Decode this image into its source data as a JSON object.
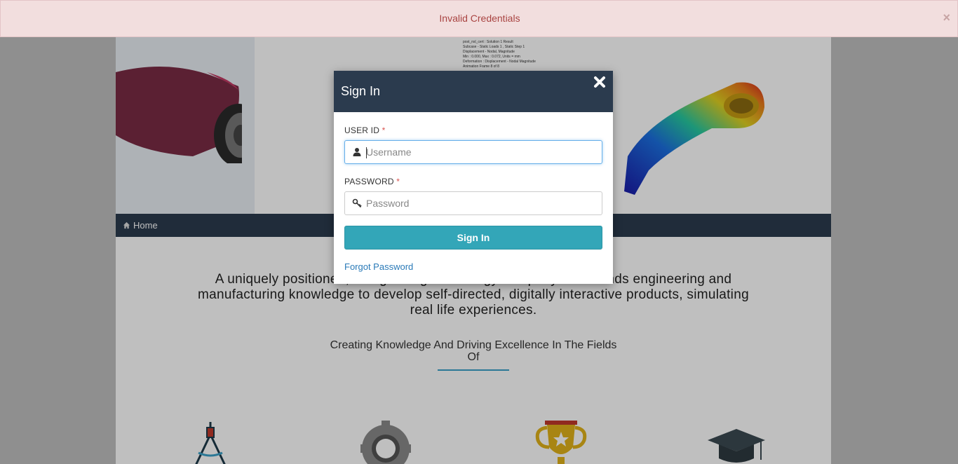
{
  "alert": {
    "message": "Invalid Credentials",
    "close_glyph": "×"
  },
  "navbar": {
    "home_label": "Home"
  },
  "hero": {
    "sim_text": "post_nsl_cert : Solution 1 Result\nSubcase - Static Loads 1 , Static Step 1\nDisplacement - Nodal, Magnitude\nMin : 0.000, Max : 0.072, Units = mm\nDeformation : Displacement - Nodal Magnitude\nAnimation Frame 8 of 8"
  },
  "intro": {
    "text": "A uniquely positioned, fast growing technology company that blends engineering and manufacturing knowledge to develop self-directed, digitally interactive products, simulating real life experiences.",
    "tagline": "Creating Knowledge And Driving Excellence In The Fields Of"
  },
  "features": [
    {
      "icon": "drafting-compass-icon"
    },
    {
      "icon": "gear-icon"
    },
    {
      "icon": "trophy-icon"
    },
    {
      "icon": "graduation-cap-icon"
    }
  ],
  "modal": {
    "title": "Sign In",
    "user_label": "USER ID",
    "user_placeholder": "Username",
    "password_label": "PASSWORD",
    "password_placeholder": "Password",
    "required_mark": "*",
    "submit_label": "Sign In",
    "forgot_label": "Forgot Password"
  },
  "colors": {
    "header": "#2b3b4e",
    "button": "#33a6b8",
    "alert_bg": "#f2dede",
    "alert_text": "#a94442",
    "link": "#2a7ab8"
  }
}
